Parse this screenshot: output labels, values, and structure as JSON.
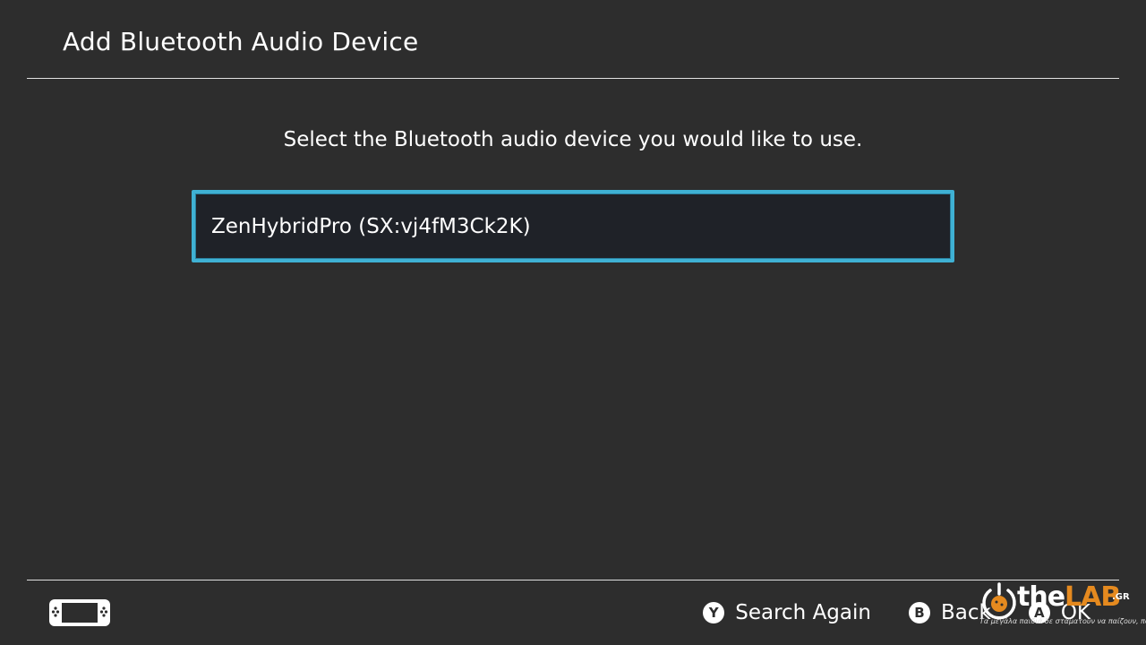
{
  "header": {
    "title": "Add Bluetooth Audio Device"
  },
  "main": {
    "instruction": "Select the Bluetooth audio device you would like to use.",
    "devices": [
      {
        "label": "ZenHybridPro (SX:vj4fM3Ck2K)",
        "selected": true
      }
    ]
  },
  "footer": {
    "console_icon": "console-handheld-icon",
    "actions": [
      {
        "glyph": "Y",
        "label": "Search Again"
      },
      {
        "glyph": "B",
        "label": "Back"
      },
      {
        "glyph": "A",
        "label": "OK"
      }
    ]
  },
  "watermark": {
    "the": "the",
    "lab": "LAB",
    "gr": ".GR",
    "tagline": "Τα μεγάλα παιδιά δε σταματούν να παίζουν, ποτέ"
  },
  "colors": {
    "background": "#2d2d2d",
    "selection_border": "#3fb1d4",
    "item_fill": "#1f2228",
    "text": "#ffffff",
    "watermark_accent": "#e58a1f"
  }
}
